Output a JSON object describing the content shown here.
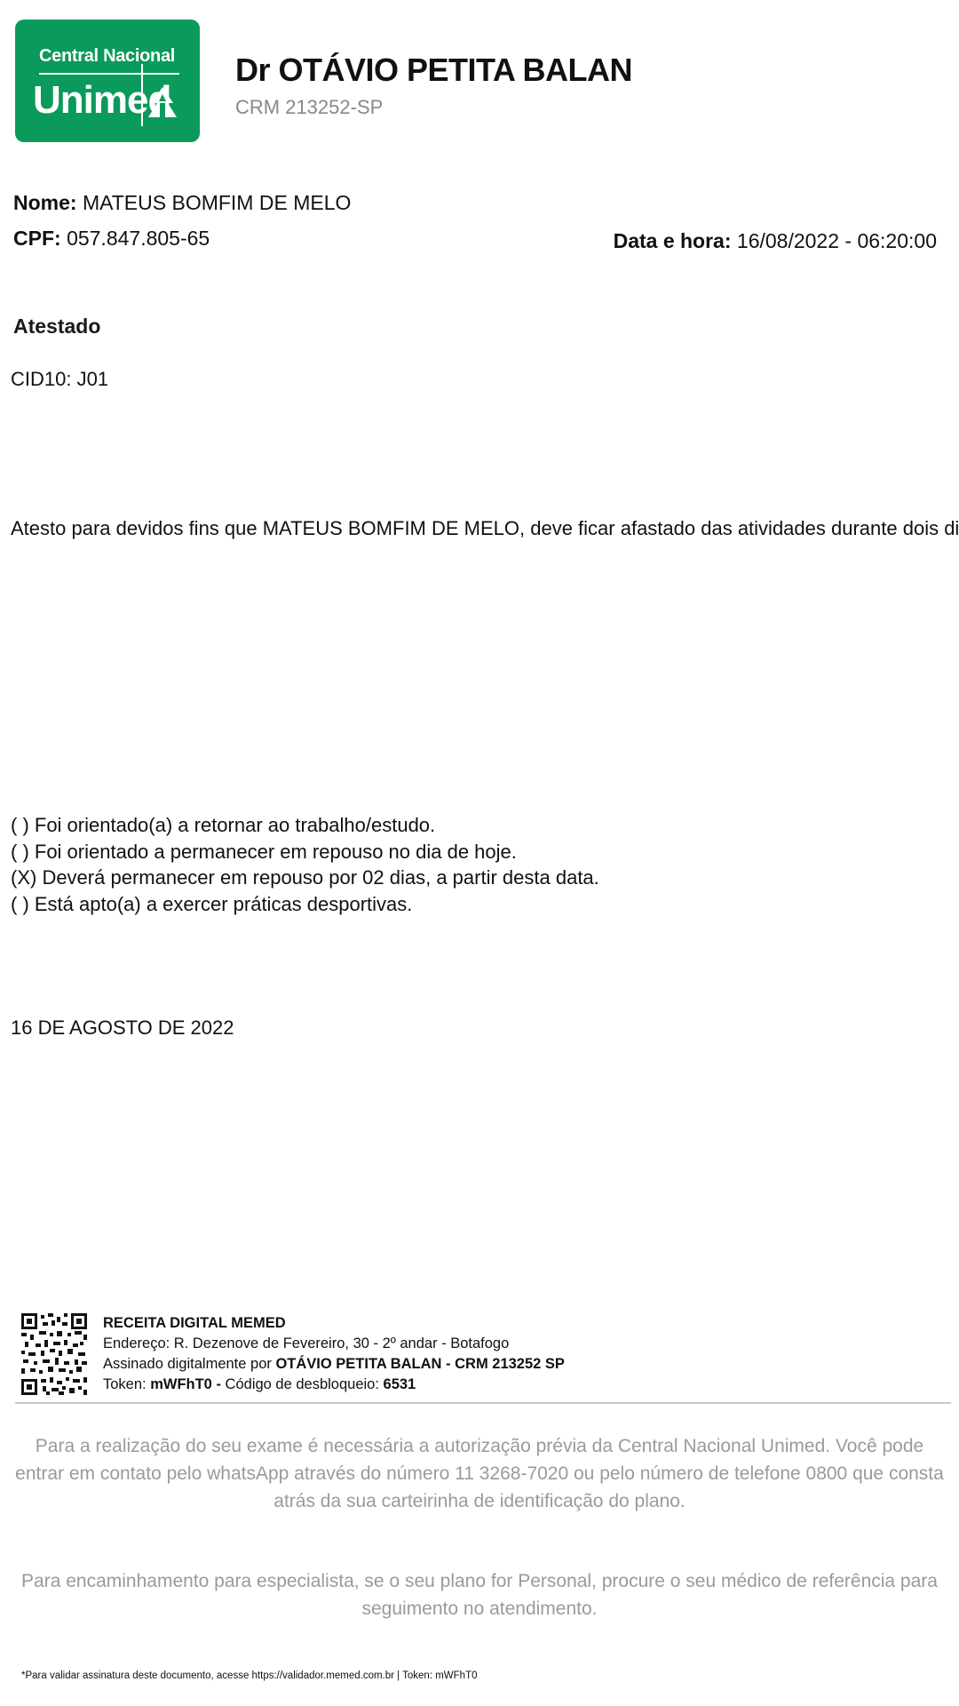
{
  "logo": {
    "line1": "Central Nacional",
    "line2": "Unimed",
    "brand_color": "#0a9a5b"
  },
  "doctor": {
    "name": "Dr OTÁVIO PETITA BALAN",
    "crm": "CRM 213252-SP"
  },
  "patient": {
    "name_label": "Nome:",
    "name": "MATEUS BOMFIM DE MELO",
    "cpf_label": "CPF:",
    "cpf": "057.847.805-65"
  },
  "datetime": {
    "label": "Data e hora:",
    "value": "16/08/2022 - 06:20:00"
  },
  "document": {
    "title": "Atestado",
    "cid": "CID10: J01",
    "statement": "Atesto para devidos fins que MATEUS BOMFIM DE MELO, deve ficar afastado das atividades durante dois dias.",
    "options": [
      "(   ) Foi orientado(a) a retornar ao trabalho/estudo.",
      "(   ) Foi orientado a permanecer em repouso no dia de hoje.",
      "(X) Deverá permanecer em repouso por 02 dias, a partir desta data.",
      "(   ) Está apto(a) a exercer práticas desportivas."
    ],
    "date": "16 DE AGOSTO DE 2022"
  },
  "signature": {
    "title": "RECEITA DIGITAL MEMED",
    "address": "Endereço: R. Dezenove de Fevereiro, 30 - 2º andar - Botafogo",
    "signed_prefix": "Assinado digitalmente por ",
    "signed_by": "OTÁVIO PETITA BALAN - CRM 213252 SP",
    "token_label": "Token: ",
    "token": "mWFhT0",
    "code_label": " - ",
    "code_prefix": "Código de desbloqueio: ",
    "code": "6531"
  },
  "notes": {
    "authorization": "Para a realização do seu exame é necessária a autorização prévia da Central Nacional Unimed. Você pode entrar em contato pelo whatsApp através do número 11 3268-7020 ou pelo número de telefone 0800 que consta atrás da sua carteirinha de identificação do plano.",
    "referral": "Para encaminhamento para especialista, se o seu plano for Personal, procure o seu médico de referência para seguimento no atendimento.",
    "validation": "*Para validar assinatura deste documento, acesse https://validador.memed.com.br | Token: mWFhT0"
  }
}
